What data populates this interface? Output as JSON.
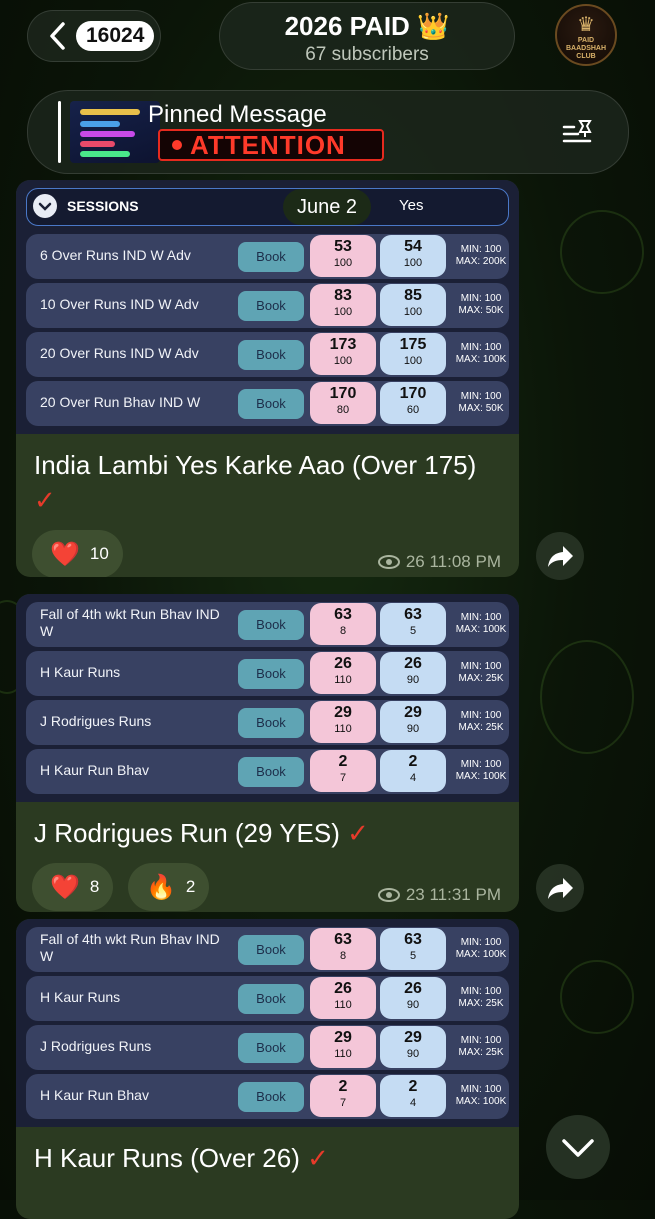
{
  "header": {
    "back_count": "16024",
    "channel_title": "2026 PAID 👑",
    "subscribers": "67 subscribers",
    "avatar_text": [
      "PAID",
      "BAADSHAH",
      "CLUB"
    ]
  },
  "pinned": {
    "label": "Pinned Message",
    "preview_text": "ATTENTION"
  },
  "date_pill": "June 2",
  "messages": [
    {
      "session_header": {
        "label": "SESSIONS",
        "yes_label": "Yes"
      },
      "rows": [
        {
          "name": "6 Over Runs IND W Adv",
          "book": "Book",
          "no_val": "53",
          "no_size": "100",
          "yes_val": "54",
          "yes_size": "100",
          "min": "MIN: 100",
          "max": "MAX: 200K"
        },
        {
          "name": "10 Over Runs IND W Adv",
          "book": "Book",
          "no_val": "83",
          "no_size": "100",
          "yes_val": "85",
          "yes_size": "100",
          "min": "MIN: 100",
          "max": "MAX: 50K"
        },
        {
          "name": "20 Over Runs IND W Adv",
          "book": "Book",
          "no_val": "173",
          "no_size": "100",
          "yes_val": "175",
          "yes_size": "100",
          "min": "MIN: 100",
          "max": "MAX: 100K"
        },
        {
          "name": "20 Over Run Bhav IND W",
          "book": "Book",
          "no_val": "170",
          "no_size": "80",
          "yes_val": "170",
          "yes_size": "60",
          "min": "MIN: 100",
          "max": "MAX: 50K"
        }
      ],
      "caption": "India Lambi Yes Karke Aao (Over 175)",
      "tick": "✓",
      "reactions": [
        {
          "emoji": "❤️",
          "count": "10"
        }
      ],
      "views": "26",
      "time": "11:08 PM"
    },
    {
      "rows": [
        {
          "name": "Fall of 4th wkt Run Bhav IND W",
          "book": "Book",
          "no_val": "63",
          "no_size": "8",
          "yes_val": "63",
          "yes_size": "5",
          "min": "MIN: 100",
          "max": "MAX: 100K"
        },
        {
          "name": "H Kaur Runs",
          "book": "Book",
          "no_val": "26",
          "no_size": "110",
          "yes_val": "26",
          "yes_size": "90",
          "min": "MIN: 100",
          "max": "MAX: 25K"
        },
        {
          "name": "J Rodrigues Runs",
          "book": "Book",
          "no_val": "29",
          "no_size": "110",
          "yes_val": "29",
          "yes_size": "90",
          "min": "MIN: 100",
          "max": "MAX: 25K"
        },
        {
          "name": "H Kaur Run Bhav",
          "book": "Book",
          "no_val": "2",
          "no_size": "7",
          "yes_val": "2",
          "yes_size": "4",
          "min": "MIN: 100",
          "max": "MAX: 100K"
        }
      ],
      "caption": "J Rodrigues Run (29 YES)",
      "tick": "✓",
      "reactions": [
        {
          "emoji": "❤️",
          "count": "8"
        },
        {
          "emoji": "🔥",
          "count": "2"
        }
      ],
      "views": "23",
      "time": "11:31 PM"
    },
    {
      "rows": [
        {
          "name": "Fall of 4th wkt Run Bhav IND W",
          "book": "Book",
          "no_val": "63",
          "no_size": "8",
          "yes_val": "63",
          "yes_size": "5",
          "min": "MIN: 100",
          "max": "MAX: 100K"
        },
        {
          "name": "H Kaur Runs",
          "book": "Book",
          "no_val": "26",
          "no_size": "110",
          "yes_val": "26",
          "yes_size": "90",
          "min": "MIN: 100",
          "max": "MAX: 25K"
        },
        {
          "name": "J Rodrigues Runs",
          "book": "Book",
          "no_val": "29",
          "no_size": "110",
          "yes_val": "29",
          "yes_size": "90",
          "min": "MIN: 100",
          "max": "MAX: 25K"
        },
        {
          "name": "H Kaur Run Bhav",
          "book": "Book",
          "no_val": "2",
          "no_size": "7",
          "yes_val": "2",
          "yes_size": "4",
          "min": "MIN: 100",
          "max": "MAX: 100K"
        }
      ],
      "caption": "H Kaur Runs (Over 26)",
      "tick": "✓"
    }
  ]
}
